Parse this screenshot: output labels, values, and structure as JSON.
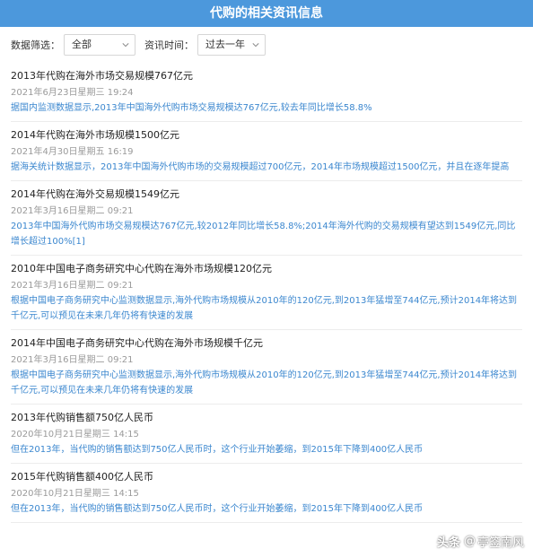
{
  "header": {
    "title": "代购的相关资讯信息"
  },
  "filters": {
    "scope_label": "数据筛选：",
    "scope_value": "全部",
    "time_label": "资讯时间：",
    "time_value": "过去一年"
  },
  "news": [
    {
      "title": "2013年代购在海外市场交易规模767亿元",
      "date": "2021年6月23日星期三 19:24",
      "summary": "据国内监测数据显示,2013年中国海外代购市场交易规模达767亿元,较去年同比增长58.8%"
    },
    {
      "title": "2014年代购在海外市场规模1500亿元",
      "date": "2021年4月30日星期五 16:19",
      "summary": "据海关统计数据显示，2013年中国海外代购市场的交易规模超过700亿元，2014年市场规模超过1500亿元，并且在逐年提高"
    },
    {
      "title": "2014年代购在海外交易规模1549亿元",
      "date": "2021年3月16日星期二 09:21",
      "summary": "2013年中国海外代购市场交易规模达767亿元,较2012年同比增长58.8%;2014年海外代购的交易规模有望达到1549亿元,同比增长超过100%[1]"
    },
    {
      "title": "2010年中国电子商务研究中心代购在海外市场规模120亿元",
      "date": "2021年3月16日星期二 09:21",
      "summary": "根据中国电子商务研究中心监测数据显示,海外代购市场规模从2010年的120亿元,到2013年猛增至744亿元,预计2014年将达到千亿元,可以预见在未来几年仍将有快速的发展"
    },
    {
      "title": "2014年中国电子商务研究中心代购在海外市场规模千亿元",
      "date": "2021年3月16日星期二 09:21",
      "summary": "根据中国电子商务研究中心监测数据显示,海外代购市场规模从2010年的120亿元,到2013年猛增至744亿元,预计2014年将达到千亿元,可以预见在未来几年仍将有快速的发展"
    },
    {
      "title": "2013年代购销售额750亿人民币",
      "date": "2020年10月21日星期三 14:15",
      "summary": "但在2013年，当代购的销售额达到750亿人民币时，这个行业开始萎缩，到2015年下降到400亿人民币"
    },
    {
      "title": "2015年代购销售额400亿人民币",
      "date": "2020年10月21日星期三 14:15",
      "summary": "但在2013年，当代购的销售额达到750亿人民币时，这个行业开始萎缩，到2015年下降到400亿人民币"
    }
  ],
  "watermark": {
    "logo": "头条",
    "at": "@",
    "name": "亭签南风"
  },
  "colors": {
    "header_bg": "#4c98dc",
    "summary_text": "#3b87cf",
    "date_text": "#9a9a9a"
  },
  "icons": {
    "select_arrow": "chevron-down-icon"
  }
}
